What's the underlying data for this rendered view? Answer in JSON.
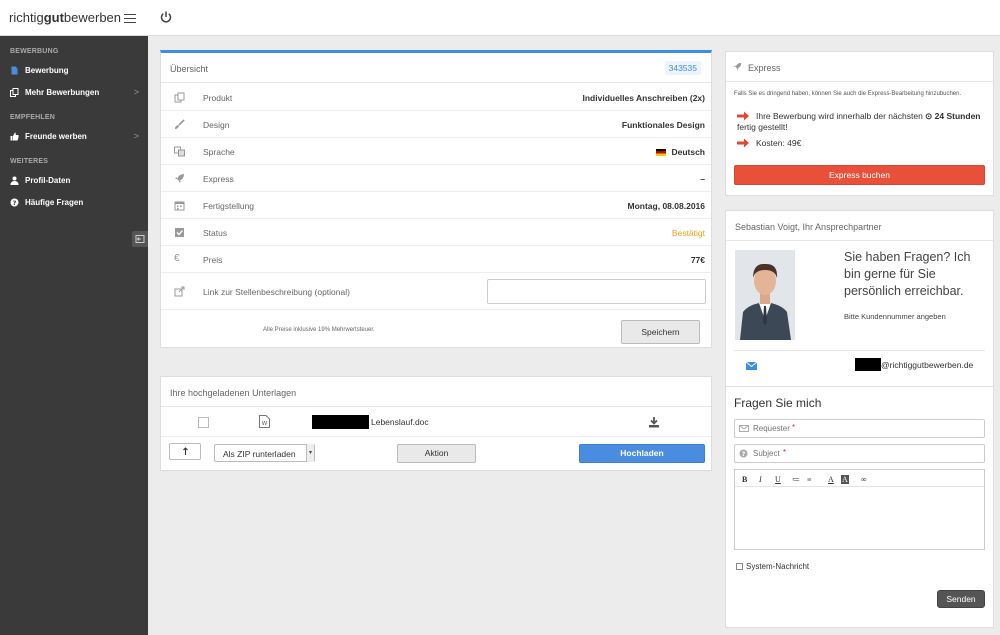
{
  "app": {
    "logo_plain": "richtig",
    "logo_bold": "gut",
    "logo_plain2": "bewerben"
  },
  "sidebar": {
    "sections": [
      "BEWERBUNG",
      "EMPFEHLEN",
      "WEITERES"
    ],
    "items": [
      {
        "label": "Bewerbung",
        "icon": "document-icon"
      },
      {
        "label": "Mehr Bewerbungen",
        "icon": "copy-icon",
        "chevron": ">"
      },
      {
        "label": "Freunde werben",
        "icon": "thumbs-up-icon",
        "chevron": ">"
      },
      {
        "label": "Profil-Daten",
        "icon": "user-icon"
      },
      {
        "label": "Häufige Fragen",
        "icon": "question-icon"
      }
    ]
  },
  "overview": {
    "title": "Übersicht",
    "order_id": "343535",
    "accent": "#3b8ee0",
    "rows": [
      {
        "key": "Produkt",
        "value": "Individuelles Anschreiben (2x)",
        "icon": "copy-icon"
      },
      {
        "key": "Design",
        "value": "Funktionales Design",
        "icon": "brush-icon"
      },
      {
        "key": "Sprache",
        "value": "Deutsch",
        "icon": "language-icon"
      },
      {
        "key": "Express",
        "value": "–",
        "icon": "rocket-icon"
      },
      {
        "key": "Fertigstellung",
        "value": "Montag, 08.08.2016",
        "icon": "calendar-icon"
      },
      {
        "key": "Status",
        "value": "Bestätigt",
        "icon": "checkbox-icon",
        "color": "#f0a020"
      },
      {
        "key": "Preis",
        "value": "77€",
        "icon": "euro-icon"
      }
    ],
    "link_label": "Link zur Stellenbeschreibung (optional)",
    "link_value": "",
    "tax_note": "Alle Preise inklusive 19% Mehrwertsteuer.",
    "save_label": "Speichern"
  },
  "uploads": {
    "title": "Ihre hochgeladenen Unterlagen",
    "files": [
      {
        "name": "Lebenslauf.doc"
      }
    ],
    "zip_option": "Als ZIP runterladen",
    "action_label": "Aktion",
    "upload_label": "Hochladen"
  },
  "express": {
    "title": "Express",
    "intro": "Falls Sie es dringend haben, können Sie auch die Express-Bearbeitung hinzubuchen.",
    "line1_a": "Ihre Bewerbung wird innerhalb der nächsten",
    "line1_b": "24 Stunden",
    "line1_c": "fertig gestellt!",
    "line2": "Kosten: 49€",
    "button": "Express buchen"
  },
  "contact": {
    "title": "Sebastian Voigt, Ihr Ansprechpartner",
    "question": "Sie haben Fragen? Ich bin gerne für Sie persönlich erreichbar.",
    "hint": "Bitte Kundennummer angeben",
    "email_suffix": "@richtiggutbewerben.de"
  },
  "ask": {
    "title": "Fragen Sie mich",
    "requester_placeholder": "Requester",
    "subject_placeholder": "Subject",
    "toolbar": [
      "B",
      "I",
      "U",
      "≔",
      "≡",
      "A",
      "A",
      "∞"
    ],
    "system_label": "System-Nachricht",
    "send_label": "Senden"
  }
}
